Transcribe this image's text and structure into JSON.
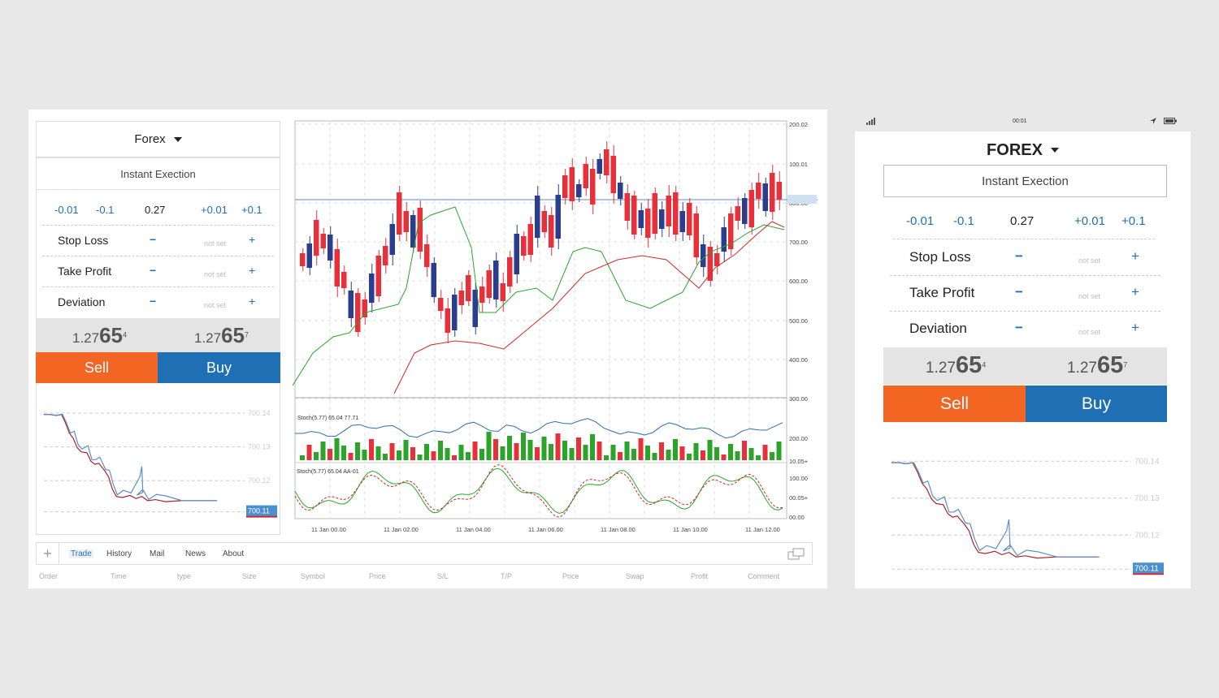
{
  "desktop": {
    "market": "Forex",
    "execution": "Instant Exection",
    "steps": {
      "m001": "-0.01",
      "m01": "-0.1",
      "value": "0.27",
      "p001": "+0.01",
      "p01": "+0.1"
    },
    "rows": [
      {
        "label": "Stop Loss",
        "value": "not set"
      },
      {
        "label": "Take Profit",
        "value": "not set"
      },
      {
        "label": "Deviation",
        "value": "not set"
      }
    ],
    "minus": "−",
    "plus": "+",
    "bid": {
      "main": "1.27",
      "big": "65",
      "sup": "4"
    },
    "ask": {
      "main": "1.27",
      "big": "65",
      "sup": "7"
    },
    "sell": "Sell",
    "buy": "Buy",
    "mini": {
      "ticks": [
        "700.14",
        "700.13",
        "700.12"
      ],
      "current": "700.11"
    },
    "chart": {
      "price_ticks": [
        "200.02",
        "100.01",
        "800.00",
        "700.00",
        "600.00",
        "500.00",
        "400.00",
        "300.00"
      ],
      "osc_ticks": [
        "200.00",
        "10.05+",
        "100.00",
        "00.05+",
        "00.00"
      ],
      "x_ticks": [
        "11 Jan 00.00",
        "11 Jan 02.00",
        "11 Jan 04.00",
        "11 Jan 06.00",
        "11 Jan 08.00",
        "11 Jan 10.00",
        "11 Jan 12.00"
      ],
      "stoch1": "Stoch(5.77) 65.04 77.71",
      "stoch2": "Stoch(5.77) 65.04 AA-01"
    },
    "tabs": {
      "add": "+",
      "items": [
        "Trade",
        "History",
        "Mail",
        "News",
        "About"
      ]
    },
    "columns": [
      "Order",
      "Time",
      "type",
      "Size",
      "Symbol",
      "Price",
      "S/L",
      "T/P",
      "Price",
      "Swap",
      "Profit",
      "Comment"
    ]
  },
  "mobile": {
    "time": "00:01",
    "market": "FOREX",
    "execution": "Instant Exection",
    "steps": {
      "m001": "-0.01",
      "m01": "-0.1",
      "value": "0.27",
      "p001": "+0.01",
      "p01": "+0.1"
    },
    "rows": [
      {
        "label": "Stop Loss",
        "value": "not set"
      },
      {
        "label": "Take Profit",
        "value": "not set"
      },
      {
        "label": "Deviation",
        "value": "not set"
      }
    ],
    "minus": "−",
    "plus": "+",
    "bid": {
      "main": "1.27",
      "big": "65",
      "sup": "4"
    },
    "ask": {
      "main": "1.27",
      "big": "65",
      "sup": "7"
    },
    "sell": "Sell",
    "buy": "Buy",
    "mini": {
      "ticks": [
        "700.14",
        "700.13",
        "700.12"
      ],
      "current": "700.11"
    }
  },
  "colors": {
    "sell": "#f26522",
    "buy": "#1f6fb5",
    "bull": "#e8303a",
    "bear": "#2b3d8f",
    "green": "#2aa52a",
    "red": "#d02828"
  },
  "icons": {
    "signal": "signal-icon",
    "location": "location-arrow-icon",
    "battery": "battery-icon",
    "window": "window-restore-icon",
    "add": "plus-icon",
    "dropdown": "caret-down-icon"
  }
}
